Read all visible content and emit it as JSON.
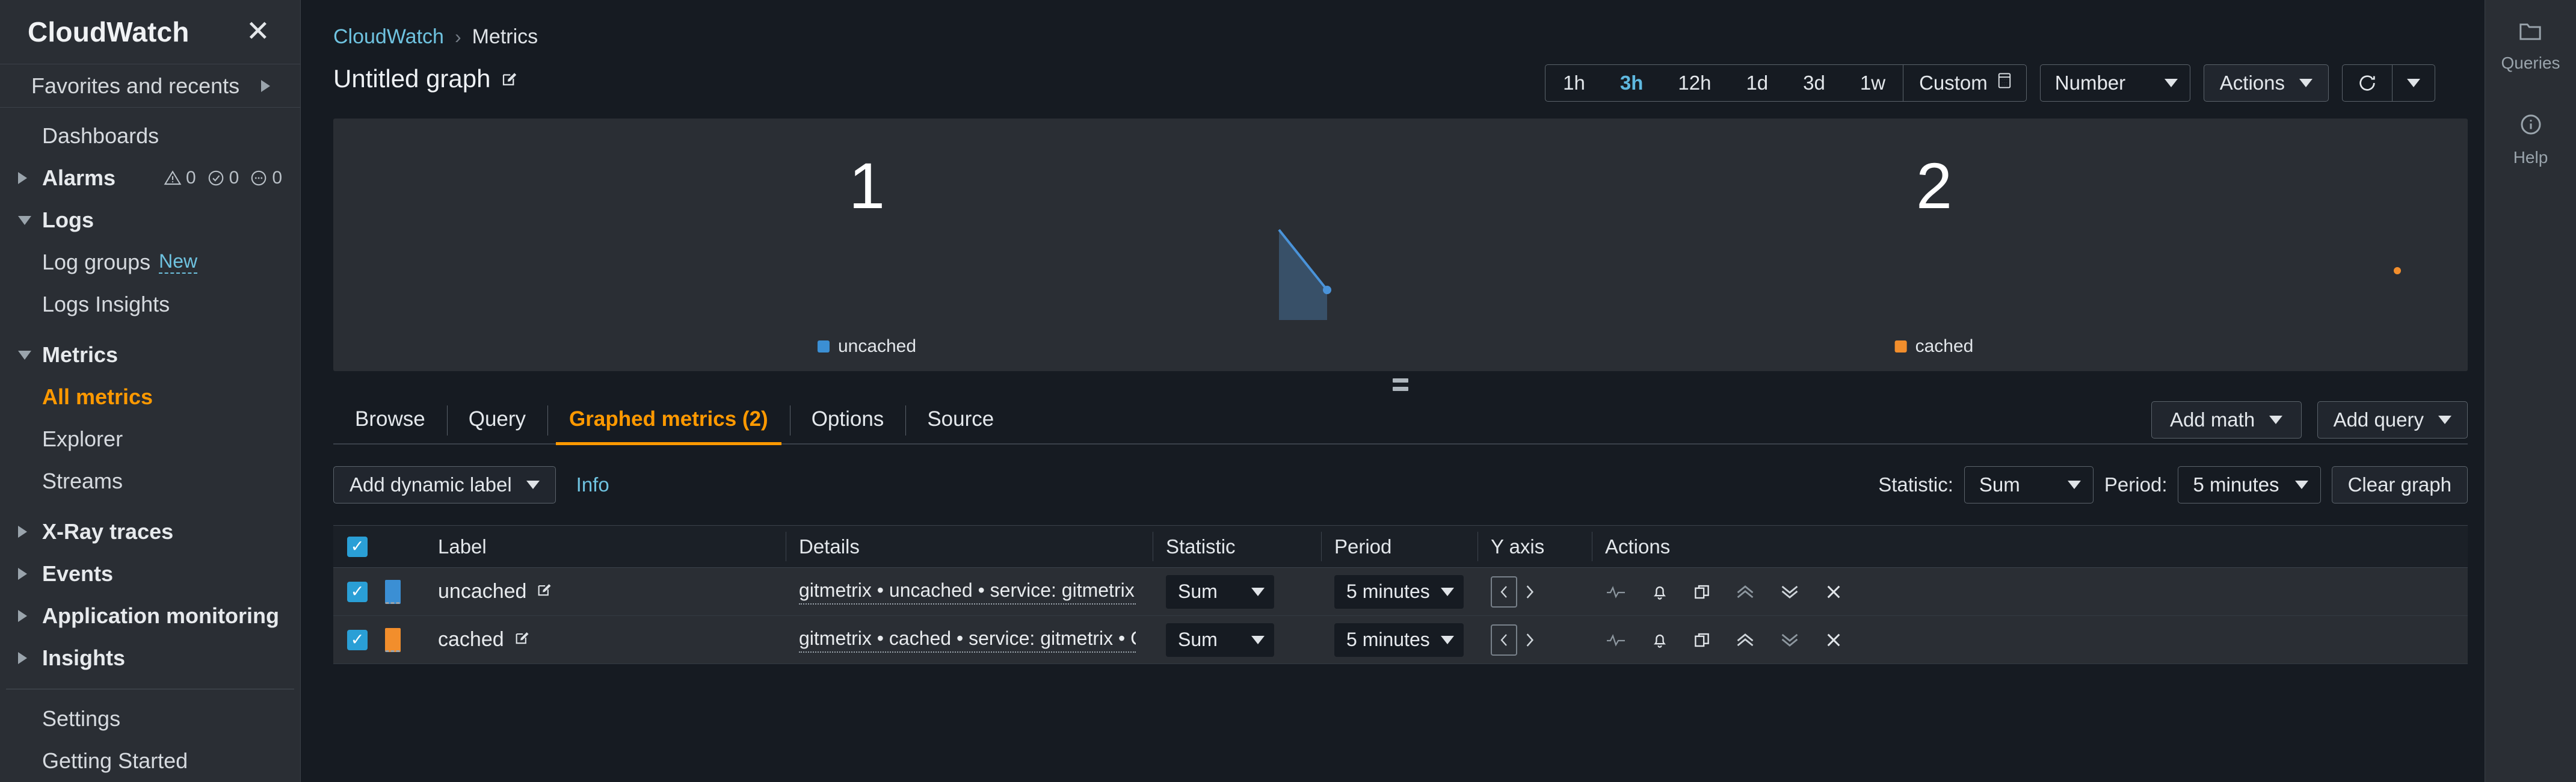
{
  "sidebar": {
    "title": "CloudWatch",
    "close_icon": "close-icon",
    "favorites_label": "Favorites and recents",
    "items": [
      {
        "label": "Dashboards",
        "type": "link",
        "indent": true
      },
      {
        "label": "Alarms",
        "type": "group",
        "expanded": false,
        "badges": [
          {
            "icon": "warning-icon",
            "count": "0"
          },
          {
            "icon": "check-circle-icon",
            "count": "0"
          },
          {
            "icon": "insufficient-data-icon",
            "count": "0"
          }
        ]
      },
      {
        "label": "Logs",
        "type": "group",
        "expanded": true
      },
      {
        "label": "Log groups",
        "type": "link",
        "indent": true,
        "tag": "New"
      },
      {
        "label": "Logs Insights",
        "type": "link",
        "indent": true
      },
      {
        "label": "Metrics",
        "type": "group",
        "expanded": true
      },
      {
        "label": "All metrics",
        "type": "link",
        "indent": true,
        "active": true
      },
      {
        "label": "Explorer",
        "type": "link",
        "indent": true
      },
      {
        "label": "Streams",
        "type": "link",
        "indent": true
      },
      {
        "label": "X-Ray traces",
        "type": "group",
        "expanded": false
      },
      {
        "label": "Events",
        "type": "group",
        "expanded": false
      },
      {
        "label": "Application monitoring",
        "type": "group",
        "expanded": false
      },
      {
        "label": "Insights",
        "type": "group",
        "expanded": false
      },
      {
        "label": "Settings",
        "type": "link",
        "indent": true,
        "after_divider": true
      },
      {
        "label": "Getting Started",
        "type": "link",
        "indent": true
      }
    ]
  },
  "breadcrumb": {
    "root": "CloudWatch",
    "separator": "›",
    "current": "Metrics"
  },
  "header": {
    "graph_title": "Untitled graph",
    "edit_icon": "edit-pencil-icon",
    "time_ranges": [
      "1h",
      "3h",
      "12h",
      "1d",
      "3d",
      "1w"
    ],
    "time_range_selected": "3h",
    "custom_label": "Custom",
    "custom_icon": "calendar-icon",
    "widget_type": "Number",
    "actions_label": "Actions",
    "refresh_icon": "refresh-icon",
    "refresh_caret_icon": "chevron-down-icon"
  },
  "chart_data": {
    "type": "number",
    "title": "Untitled graph",
    "widgets": [
      {
        "value": "1",
        "legend": "uncached",
        "color": "#3b8fd4",
        "sparkline": "area",
        "points": [
          0.92,
          0.35
        ]
      },
      {
        "value": "2",
        "legend": "cached",
        "color": "#f28e2c",
        "sparkline": "dot",
        "points": [
          1.0
        ]
      }
    ],
    "period": "5 minutes",
    "statistic": "Sum",
    "time_range": "3h"
  },
  "tabs": {
    "items": [
      {
        "label": "Browse",
        "active": false
      },
      {
        "label": "Query",
        "active": false
      },
      {
        "label": "Graphed metrics (2)",
        "active": true
      },
      {
        "label": "Options",
        "active": false
      },
      {
        "label": "Source",
        "active": false
      }
    ],
    "add_math_label": "Add math",
    "add_query_label": "Add query"
  },
  "toolbar": {
    "add_dynamic_label": "Add dynamic label",
    "info_label": "Info",
    "statistic_label": "Statistic:",
    "statistic_value": "Sum",
    "period_label": "Period:",
    "period_value": "5 minutes",
    "clear_graph_label": "Clear graph"
  },
  "table": {
    "headers": [
      "Label",
      "Details",
      "Statistic",
      "Period",
      "Y axis",
      "Actions"
    ],
    "rows": [
      {
        "checked": true,
        "color": "#3b8fd4",
        "label": "uncached",
        "details": "gitmetrix • uncached • service: gitmetrix • Cac",
        "statistic": "Sum",
        "period": "5 minutes",
        "yaxis": "left",
        "actions": [
          "anomaly-detection-icon",
          "alarm-bell-icon",
          "duplicate-icon",
          "move-up-icon",
          "move-down-icon",
          "remove-icon"
        ]
      },
      {
        "checked": true,
        "color": "#f28e2c",
        "label": "cached",
        "details": "gitmetrix • cached • service: gitmetrix • Cache",
        "statistic": "Sum",
        "period": "5 minutes",
        "yaxis": "left",
        "actions": [
          "anomaly-detection-icon",
          "alarm-bell-icon",
          "duplicate-icon",
          "move-up-icon",
          "move-down-icon",
          "remove-icon"
        ]
      }
    ]
  },
  "rail": {
    "items": [
      {
        "label": "Queries",
        "icon": "folder-icon"
      },
      {
        "label": "Help",
        "icon": "info-circle-icon"
      }
    ]
  },
  "colors": {
    "accent": "#ff9900",
    "link": "#6fc3e0",
    "series_1": "#3b8fd4",
    "series_2": "#f28e2c",
    "panel": "#2a2e34",
    "page": "#161b22"
  }
}
